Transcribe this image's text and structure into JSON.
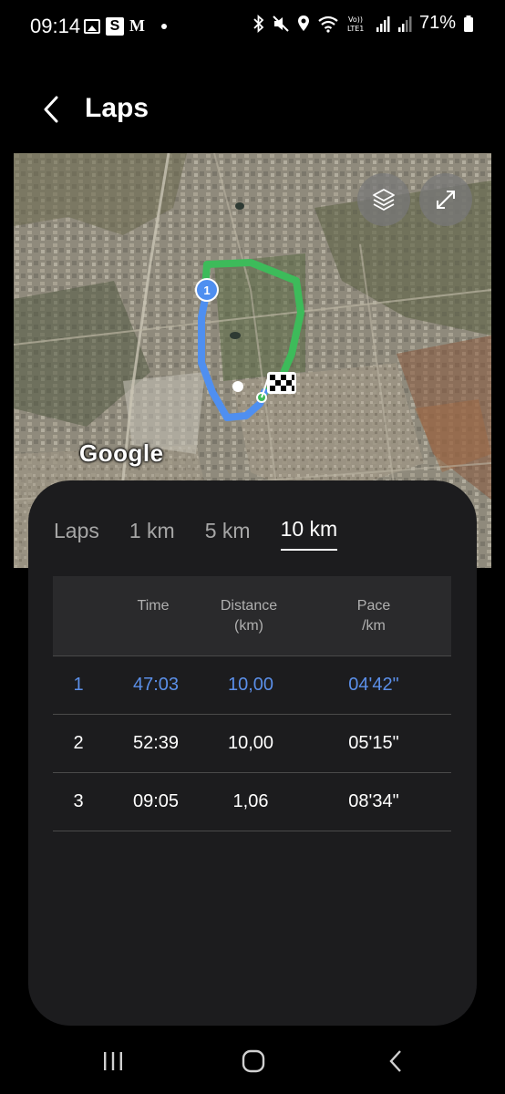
{
  "status_bar": {
    "time": "09:14",
    "s_badge": "S",
    "m_label": "M",
    "battery": "71%"
  },
  "header": {
    "title": "Laps"
  },
  "map": {
    "attribution": "Google",
    "start_marker": "1"
  },
  "tabs": [
    {
      "label": "Laps",
      "active": false
    },
    {
      "label": "1 km",
      "active": false
    },
    {
      "label": "5 km",
      "active": false
    },
    {
      "label": "10 km",
      "active": true
    }
  ],
  "table": {
    "headers": {
      "time": "Time",
      "distance_line1": "Distance",
      "distance_line2": "(km)",
      "pace_line1": "Pace",
      "pace_line2": "/km"
    },
    "rows": [
      {
        "num": "1",
        "time": "47:03",
        "distance": "10,00",
        "pace": "04'42\"",
        "highlight": true
      },
      {
        "num": "2",
        "time": "52:39",
        "distance": "10,00",
        "pace": "05'15\"",
        "highlight": false
      },
      {
        "num": "3",
        "time": "09:05",
        "distance": "1,06",
        "pace": "08'34\"",
        "highlight": false
      }
    ]
  },
  "colors": {
    "accent_blue": "#5b8fe8",
    "route_green": "#3dbb5a",
    "route_blue": "#4f8ff0",
    "sheet_bg": "#1c1c1e"
  }
}
